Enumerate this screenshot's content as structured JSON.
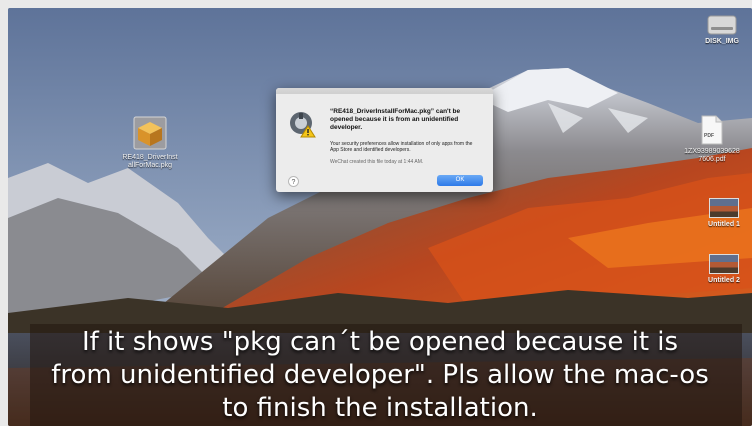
{
  "desktop": {
    "icons": [
      {
        "id": "pkg",
        "label": "RE418_DriverInst\nallForMac.pkg",
        "icon": "package-icon"
      },
      {
        "id": "hd",
        "label": "DISK_IMG",
        "icon": "hard-drive-icon"
      },
      {
        "id": "pdf",
        "label": "1ZX93989039628\n7606.pdf",
        "icon": "pdf-document-icon",
        "badge": "PDF"
      },
      {
        "id": "untitled1",
        "label": "Untitled 1",
        "icon": "screenshot-thumbnail-icon"
      },
      {
        "id": "untitled2",
        "label": "Untitled 2",
        "icon": "screenshot-thumbnail-icon"
      }
    ]
  },
  "dialog": {
    "icon": "gatekeeper-security-icon",
    "title": "“RE418_DriverInstallForMac.pkg” can't be opened because it is from an unidentified developer.",
    "body": "Your security preferences allow installation of only apps from the App Store and identified developers.",
    "meta": "WeChat created this file today at 1:44 AM.",
    "ok_label": "OK",
    "help_label": "?"
  },
  "caption": {
    "line1": "If it shows \"pkg can´t be opened because it is",
    "line2": "from unidentified developer\". Pls allow the mac-os",
    "line3": "to finish the installation."
  },
  "colors": {
    "accent_button": "#2d7ae8",
    "caption_text": "#ffffff"
  }
}
